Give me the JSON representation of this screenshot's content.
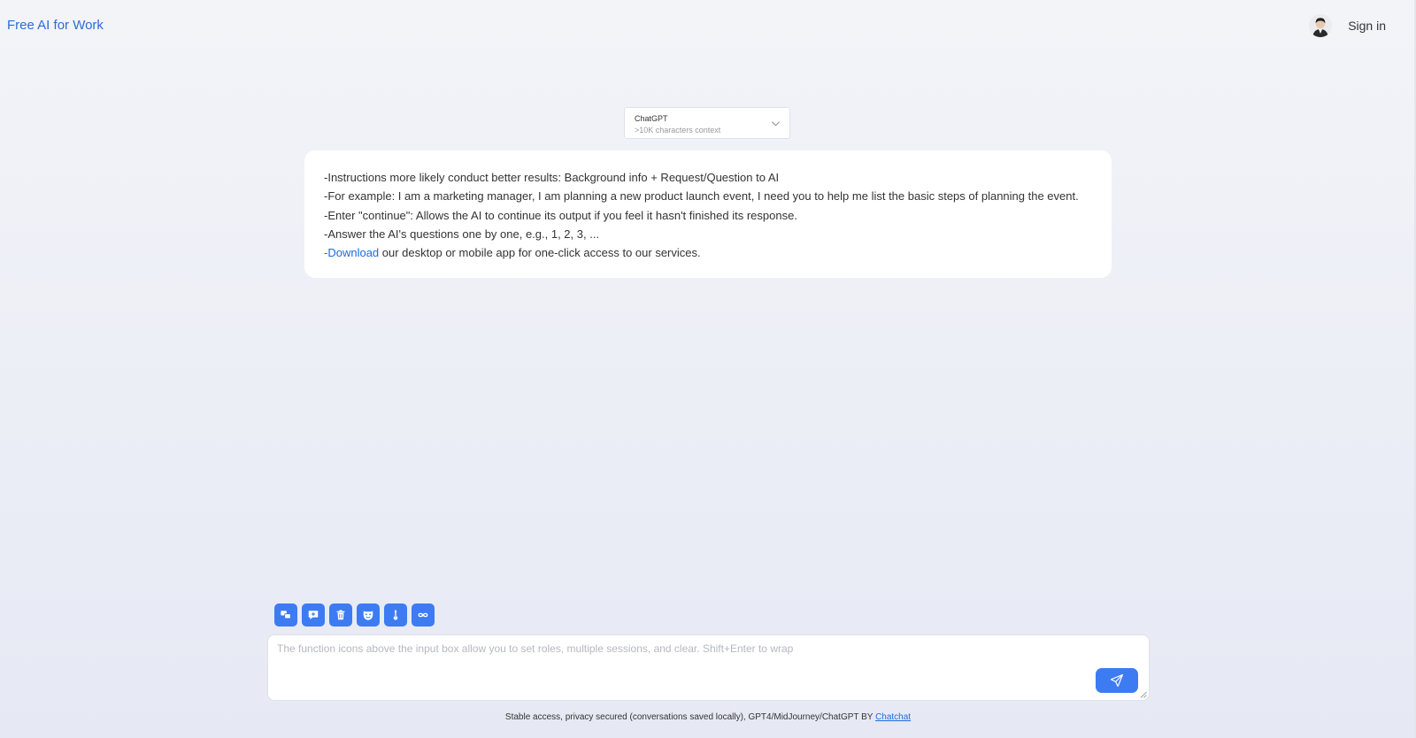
{
  "header": {
    "title": "Free AI for Work",
    "signin_label": "Sign in"
  },
  "model_select": {
    "name": "ChatGPT",
    "subtitle": ">10K characters context",
    "icon": "chevron-down-icon"
  },
  "instructions": {
    "line1": "-Instructions more likely conduct better results: Background info + Request/Question to AI",
    "line2": "-For example: I am a marketing manager, I am planning a new product launch event, I need you to help me list the basic steps of planning the event.",
    "line3": "-Enter \"continue\": Allows the AI to continue its output if you feel it hasn't finished its response.",
    "line4": "-Answer the AI's questions one by one, e.g., 1, 2, 3, ...",
    "line5_prefix": "-",
    "line5_link": "Download",
    "line5_rest": " our desktop or mobile app for one-click access to our services."
  },
  "toolbar": {
    "icons": [
      "chat-bubbles-icon",
      "new-chat-icon",
      "trash-icon",
      "mask-icon",
      "temperature-icon",
      "infinity-icon"
    ]
  },
  "input": {
    "value": "",
    "placeholder": "The function icons above the input box allow you to set roles, multiple sessions, and clear. Shift+Enter to wrap",
    "send_icon": "paper-plane-icon"
  },
  "footer": {
    "text": "Stable access, privacy secured (conversations saved locally), GPT4/MidJourney/ChatGPT BY ",
    "link": "Chatchat"
  },
  "colors": {
    "accent": "#3d7bf2",
    "link": "#1a6ce0",
    "title": "#2b6cd8"
  }
}
